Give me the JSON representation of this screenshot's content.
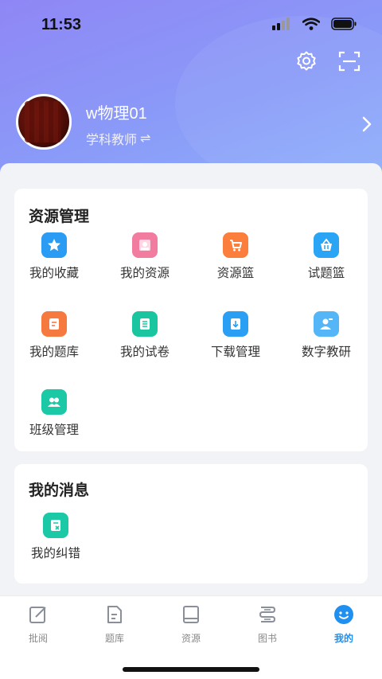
{
  "status_bar": {
    "time": "11:53"
  },
  "profile": {
    "name": "w物理01",
    "role": "学科教师",
    "switch_icon": "⇌"
  },
  "resource_section": {
    "title": "资源管理",
    "items": [
      {
        "label": "我的收藏",
        "icon": "star-icon",
        "color": "#2b9cf3"
      },
      {
        "label": "我的资源",
        "icon": "resource-icon",
        "color": "#f27ba0"
      },
      {
        "label": "资源篮",
        "icon": "cart-icon",
        "color": "#fb7e3c"
      },
      {
        "label": "试题篮",
        "icon": "basket-icon",
        "color": "#2aa4f4"
      },
      {
        "label": "我的题库",
        "icon": "question-bank-icon",
        "color": "#f67a3f"
      },
      {
        "label": "我的试卷",
        "icon": "test-paper-icon",
        "color": "#19c6a0"
      },
      {
        "label": "下载管理",
        "icon": "download-icon",
        "color": "#2a9ff4"
      },
      {
        "label": "数字教研",
        "icon": "teaching-research-icon",
        "color": "#55b6f7"
      },
      {
        "label": "班级管理",
        "icon": "class-icon",
        "color": "#1bc9a6"
      }
    ]
  },
  "message_section": {
    "title": "我的消息",
    "items": [
      {
        "label": "我的纠错",
        "icon": "error-correction-icon",
        "color": "#1bc9a6"
      }
    ]
  },
  "tabbar": {
    "tabs": [
      {
        "label": "批阅",
        "icon": "review-icon"
      },
      {
        "label": "题库",
        "icon": "question-bank-tab-icon"
      },
      {
        "label": "资源",
        "icon": "resources-tab-icon"
      },
      {
        "label": "图书",
        "icon": "books-tab-icon"
      },
      {
        "label": "我的",
        "icon": "mine-tab-icon",
        "active": true
      }
    ]
  },
  "colors": {
    "accent": "#1f8ff0",
    "header_gradient_start": "#8f86f5",
    "header_gradient_end": "#8fb0fb"
  }
}
